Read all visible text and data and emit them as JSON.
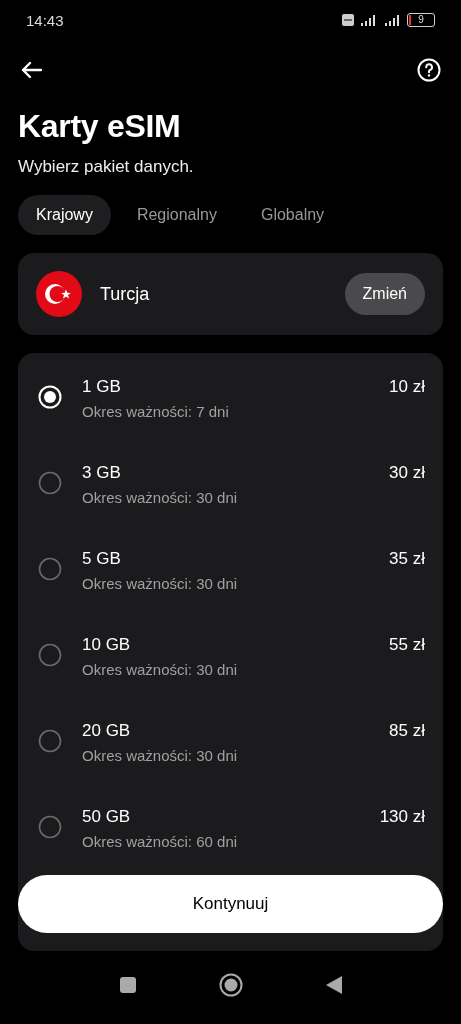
{
  "status_bar": {
    "time": "14:43",
    "battery": "9"
  },
  "header": {
    "title": "Karty eSIM",
    "subtitle": "Wybierz pakiet danych."
  },
  "tabs": [
    {
      "label": "Krajowy",
      "selected": true
    },
    {
      "label": "Regionalny",
      "selected": false
    },
    {
      "label": "Globalny",
      "selected": false
    }
  ],
  "country": {
    "name": "Turcja",
    "button": "Zmień"
  },
  "plans": [
    {
      "data": "1 GB",
      "validity": "Okres ważności: 7 dni",
      "price": "10 zł",
      "selected": true
    },
    {
      "data": "3 GB",
      "validity": "Okres ważności: 30 dni",
      "price": "30 zł",
      "selected": false
    },
    {
      "data": "5 GB",
      "validity": "Okres ważności: 30 dni",
      "price": "35 zł",
      "selected": false
    },
    {
      "data": "10 GB",
      "validity": "Okres ważności: 30 dni",
      "price": "55 zł",
      "selected": false
    },
    {
      "data": "20 GB",
      "validity": "Okres ważności: 30 dni",
      "price": "85 zł",
      "selected": false
    },
    {
      "data": "50 GB",
      "validity": "Okres ważności: 60 dni",
      "price": "130 zł",
      "selected": false
    }
  ],
  "continue_button": "Kontynuuj"
}
